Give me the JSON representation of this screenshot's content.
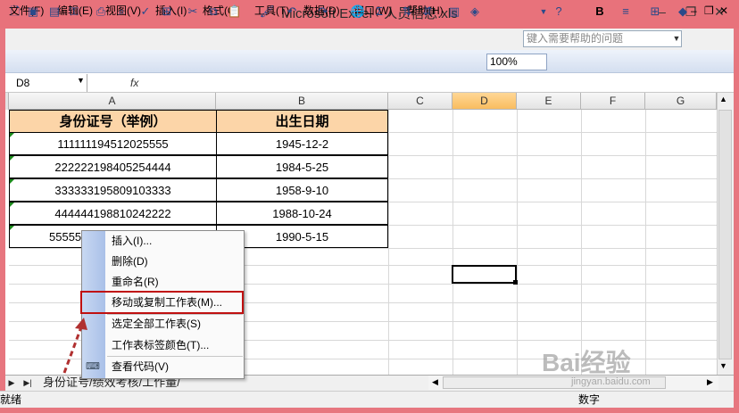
{
  "window": {
    "title": "Microsoft Excel - 人员信息.xls"
  },
  "menubar": {
    "items": [
      "文件(F)",
      "编辑(E)",
      "视图(V)",
      "插入(I)",
      "格式(O)",
      "工具(T)",
      "数据(D)",
      "窗口(W)",
      "帮助(H)"
    ],
    "help_placeholder": "键入需要帮助的问题"
  },
  "toolbar": {
    "zoom": "100%",
    "icons": [
      "new-icon",
      "open-icon",
      "save-icon",
      "permission-icon",
      "email-icon",
      "print-icon",
      "print-preview-icon",
      "spelling-icon",
      "research-icon",
      "cut-icon",
      "copy-icon",
      "paste-icon",
      "format-painter-icon",
      "undo-icon",
      "redo-icon",
      "hyperlink-icon",
      "autosum-icon",
      "sort-asc-icon",
      "sort-desc-icon",
      "chart-wizard-icon",
      "drawing-icon",
      "help-icon",
      "bold-icon",
      "align-icon",
      "borders-icon",
      "fill-color-icon"
    ]
  },
  "formula_bar": {
    "name_box": "D8",
    "fx": "fx",
    "value": ""
  },
  "columns": [
    "A",
    "B",
    "C",
    "D",
    "E",
    "F",
    "G"
  ],
  "selected_column": "D",
  "table": {
    "headers": [
      "身份证号（举例）",
      "出生日期"
    ],
    "rows": [
      [
        "111111194512025555",
        "1945-12-2"
      ],
      [
        "222222198405254444",
        "1984-5-25"
      ],
      [
        "333333195809103333",
        "1958-9-10"
      ],
      [
        "444444198810242222",
        "1988-10-24"
      ],
      [
        "55555",
        "1990-5-15"
      ]
    ]
  },
  "context_menu": {
    "items": [
      "插入(I)...",
      "删除(D)",
      "重命名(R)",
      "移动或复制工作表(M)...",
      "选定全部工作表(S)",
      "工作表标签颜色(T)...",
      "查看代码(V)"
    ],
    "highlighted": "移动或复制工作表(M)..."
  },
  "sheet_tabs": {
    "visible_text": "身份证号/绩效考核/工作量/"
  },
  "status": {
    "left": "就绪",
    "right": "数字"
  },
  "watermark": {
    "text": "Bai经验",
    "sub": "jingyan.baidu.com"
  },
  "colors": {
    "title_bar": "#e8727b",
    "header_fill": "#fcd5a8",
    "highlight_border": "#c01010"
  }
}
